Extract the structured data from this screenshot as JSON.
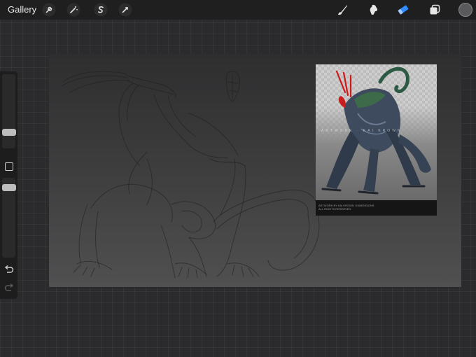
{
  "topbar": {
    "gallery_label": "Gallery",
    "left_tools": [
      "wrench-icon",
      "magic-wand-icon",
      "selection-s-icon",
      "transform-arrow-icon"
    ],
    "right_tools": [
      "brush-icon",
      "smudge-icon",
      "eraser-icon",
      "layers-icon"
    ],
    "active_tool": "eraser",
    "current_color": "#5a5a5c"
  },
  "sidebar": {
    "brush_size": 0.35,
    "opacity": 0.8,
    "controls": [
      "size-slider",
      "modify-button",
      "opacity-slider",
      "undo-icon",
      "redo-icon"
    ]
  },
  "canvas": {
    "reference_image": {
      "watermark": "ARTWORK · KAI KROWN",
      "caption_line1": "ARTWORK BY KAI KROWN / DIMENSIONS",
      "caption_line2": "ALL RIGHTS RESERVED"
    }
  },
  "colors": {
    "accent": "#2f8cff",
    "ui_background": "#1f1f20",
    "canvas_bg": "#3c3c3d"
  }
}
